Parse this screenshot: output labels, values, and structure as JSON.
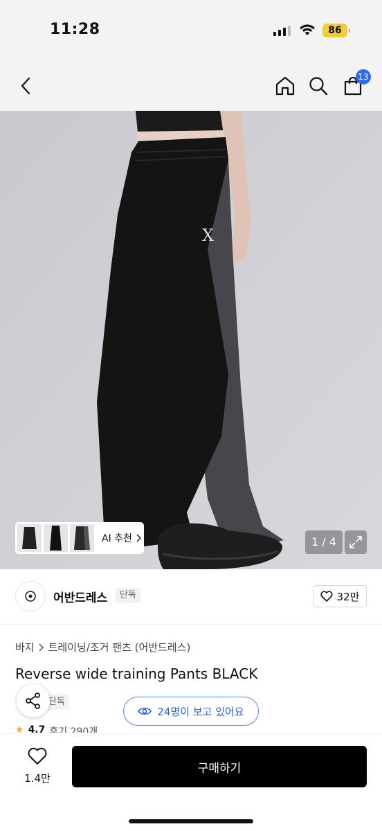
{
  "status_bar": {
    "time": "11:28",
    "battery": "86"
  },
  "nav": {
    "cart_count": "13",
    "icons": [
      "back-icon",
      "home-icon",
      "search-icon",
      "cart-icon"
    ]
  },
  "gallery": {
    "ai_recommend": "AI 추천",
    "page_indicator": "1 / 4",
    "logo_mark": "X"
  },
  "brand": {
    "name": "어반드레스",
    "tag": "단독",
    "likes": "32만"
  },
  "product": {
    "breadcrumb": [
      "바지",
      "트레이닝/조거 팬츠 (어반드레스)"
    ],
    "title": "Reverse wide training Pants BLACK",
    "tag": "단독",
    "rating": "4.7",
    "reviews": "후기 290개",
    "viewing": "24명이 보고 있어요"
  },
  "bottom_bar": {
    "like_count": "1.4만",
    "buy_label": "구매하기"
  },
  "colors": {
    "accent_blue": "#2f6bea",
    "battery": "#f2cc3b",
    "buy_button": "#000000"
  }
}
